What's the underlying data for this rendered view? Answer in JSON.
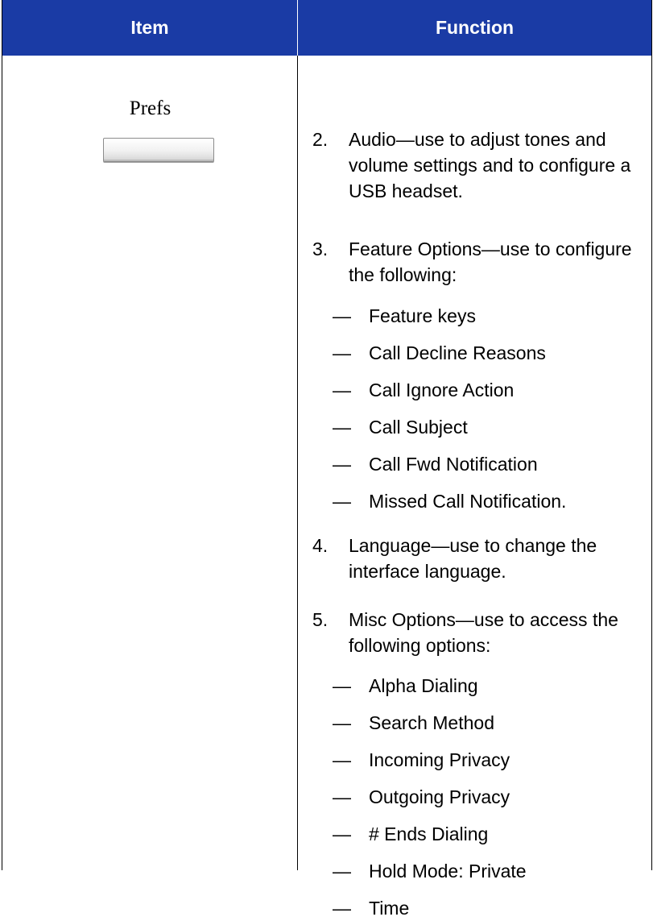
{
  "table": {
    "header": {
      "item": "Item",
      "function": "Function"
    },
    "row": {
      "item_label": "Prefs",
      "numbered": [
        {
          "num": "2.",
          "text": "Audio—use to adjust tones and volume settings and to configure a USB headset."
        },
        {
          "num": "3.",
          "text": "Feature Options—use to configure the following:"
        },
        {
          "num": "4.",
          "text": "Language—use to change the interface language."
        },
        {
          "num": "5.",
          "text": "Misc Options—use to access the following options:"
        }
      ],
      "dash": "—",
      "feature_options": [
        "Feature keys",
        "Call Decline Reasons",
        "Call Ignore Action",
        "Call Subject",
        "Call Fwd Notification",
        "Missed Call Notification."
      ],
      "misc_options": [
        "Alpha Dialing",
        "Search Method",
        "Incoming Privacy",
        "Outgoing Privacy",
        "# Ends Dialing",
        "Hold Mode: Private",
        "Time"
      ]
    }
  }
}
